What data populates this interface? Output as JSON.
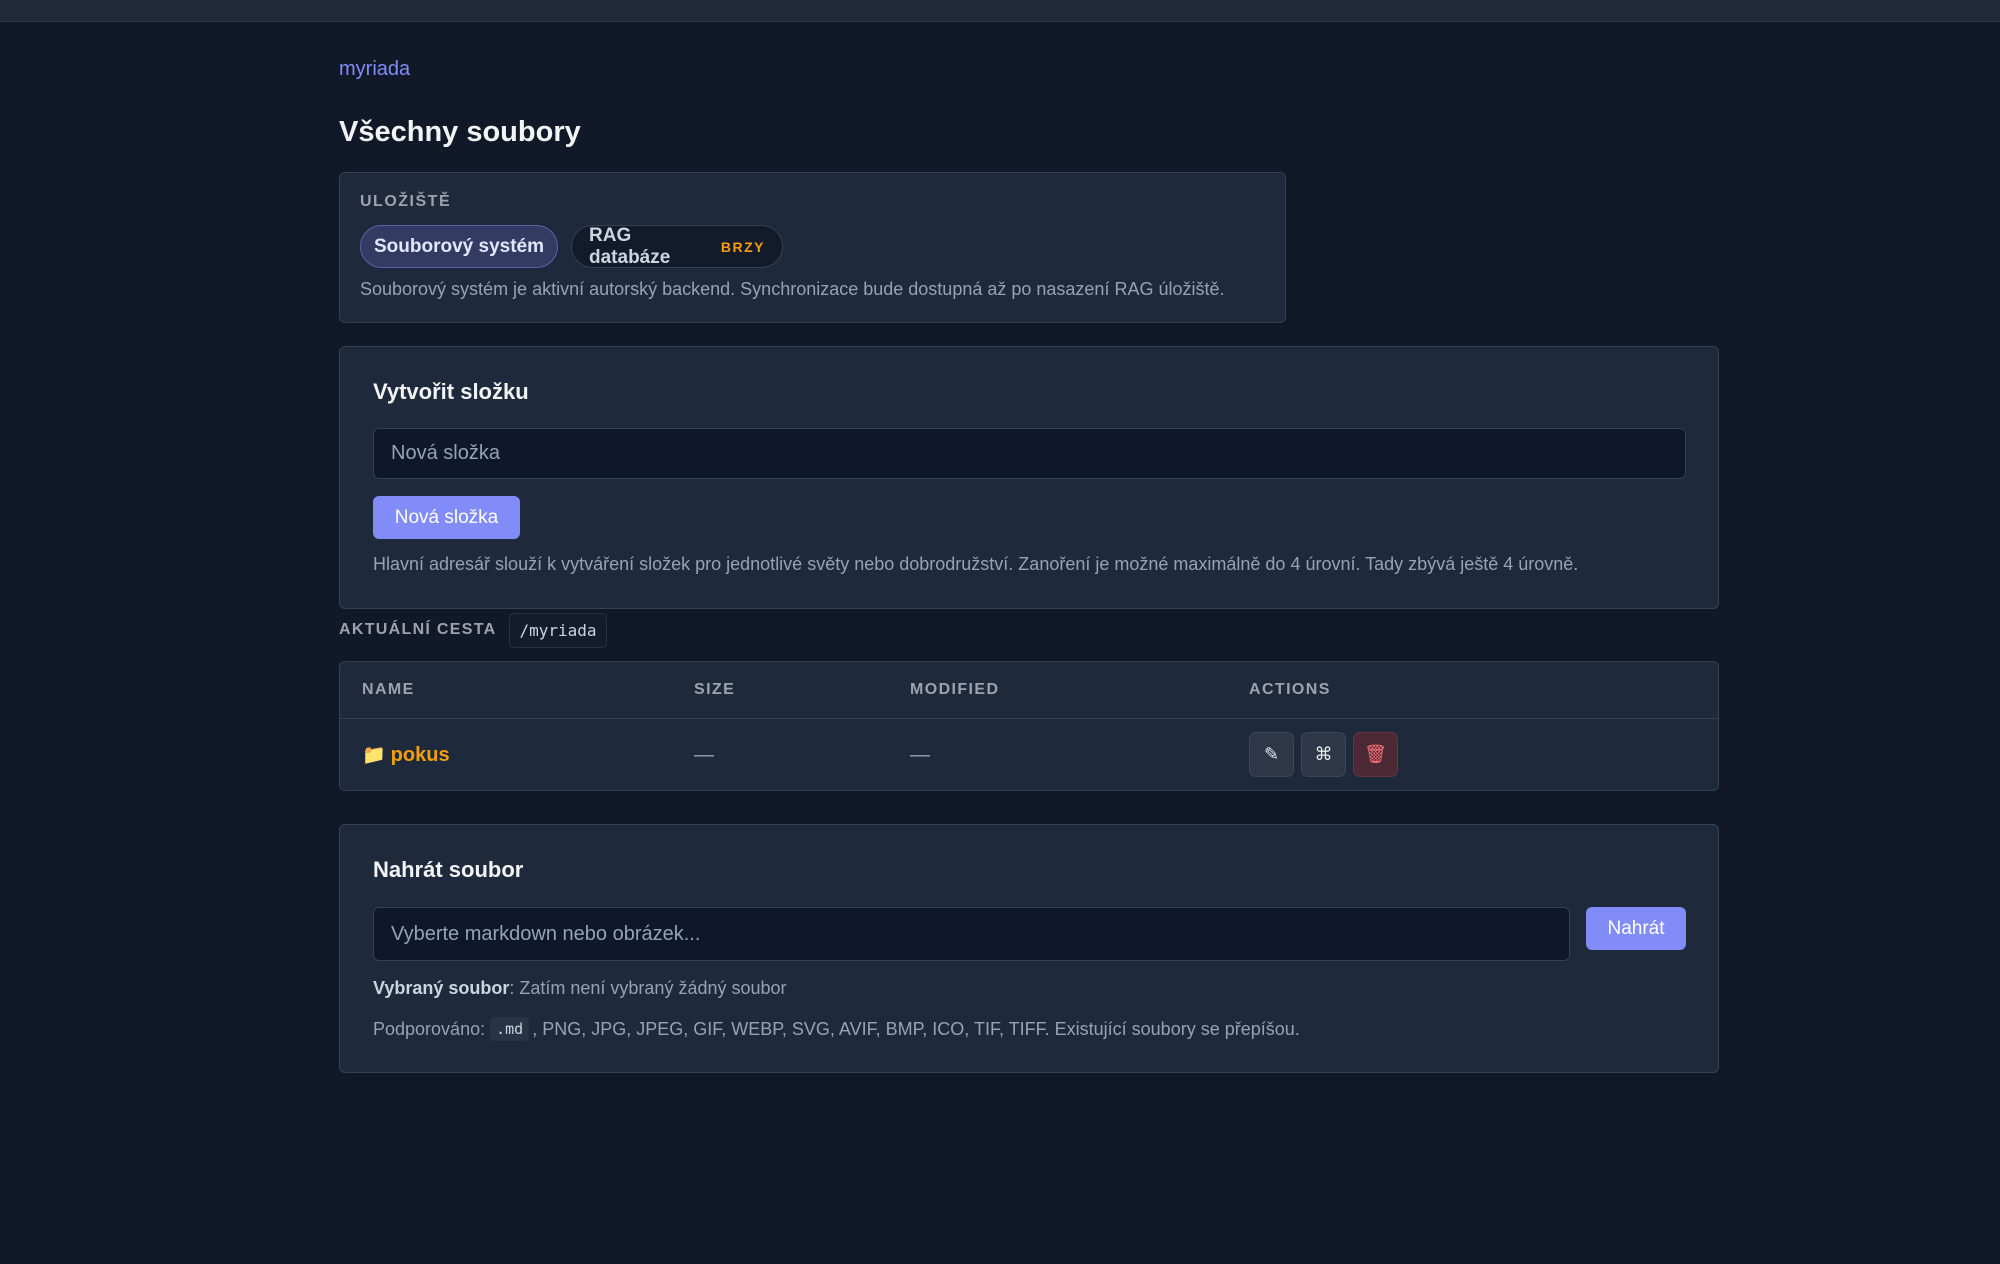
{
  "breadcrumb": {
    "label": "myriada"
  },
  "page": {
    "title": "Všechny soubory"
  },
  "storage": {
    "heading": "ULOŽIŠTĚ",
    "options": [
      {
        "label": "Souborový systém",
        "selected": true
      },
      {
        "label": "RAG databáze",
        "badge": "BRZY",
        "selected": false
      }
    ],
    "description": "Souborový systém je aktivní autorský backend. Synchronizace bude dostupná až po nasazení RAG úložiště."
  },
  "create_folder": {
    "title": "Vytvořit složku",
    "input_placeholder": "Nová složka",
    "button_label": "Nová složka",
    "help": "Hlavní adresář slouží k vytváření složek pro jednotlivé světy nebo dobrodružství. Zanoření je možné maximálně do 4 úrovní. Tady zbývá ještě 4 úrovně."
  },
  "current_path": {
    "label": "AKTUÁLNÍ CESTA",
    "value": "/myriada"
  },
  "table": {
    "headers": [
      "NAME",
      "SIZE",
      "MODIFIED",
      "ACTIONS"
    ],
    "rows": [
      {
        "icon": "📁",
        "name": "pokus",
        "size": "—",
        "modified": "—"
      }
    ],
    "actions": [
      {
        "icon": "pencil-icon",
        "glyph": "✎"
      },
      {
        "icon": "command-icon",
        "glyph": "⌘"
      },
      {
        "icon": "trash-icon",
        "glyph": "🗑"
      }
    ]
  },
  "upload": {
    "title": "Nahrát soubor",
    "input_placeholder": "Vyberte markdown nebo obrázek...",
    "button_label": "Nahrát",
    "selected_label": "Vybraný soubor",
    "selected_value": ": Zatím není vybraný žádný soubor",
    "supported_prefix": "Podporováno:",
    "supported_code": ".md",
    "supported_rest": ", PNG, JPG, JPEG, GIF, WEBP, SVG, AVIF, BMP, ICO, TIF, TIFF. Existující soubory se přepíšou."
  },
  "colors": {
    "background": "#111827",
    "card": "#1e293b",
    "accent": "#818cf8",
    "folder": "#f59e0b",
    "danger": "#f87171"
  }
}
